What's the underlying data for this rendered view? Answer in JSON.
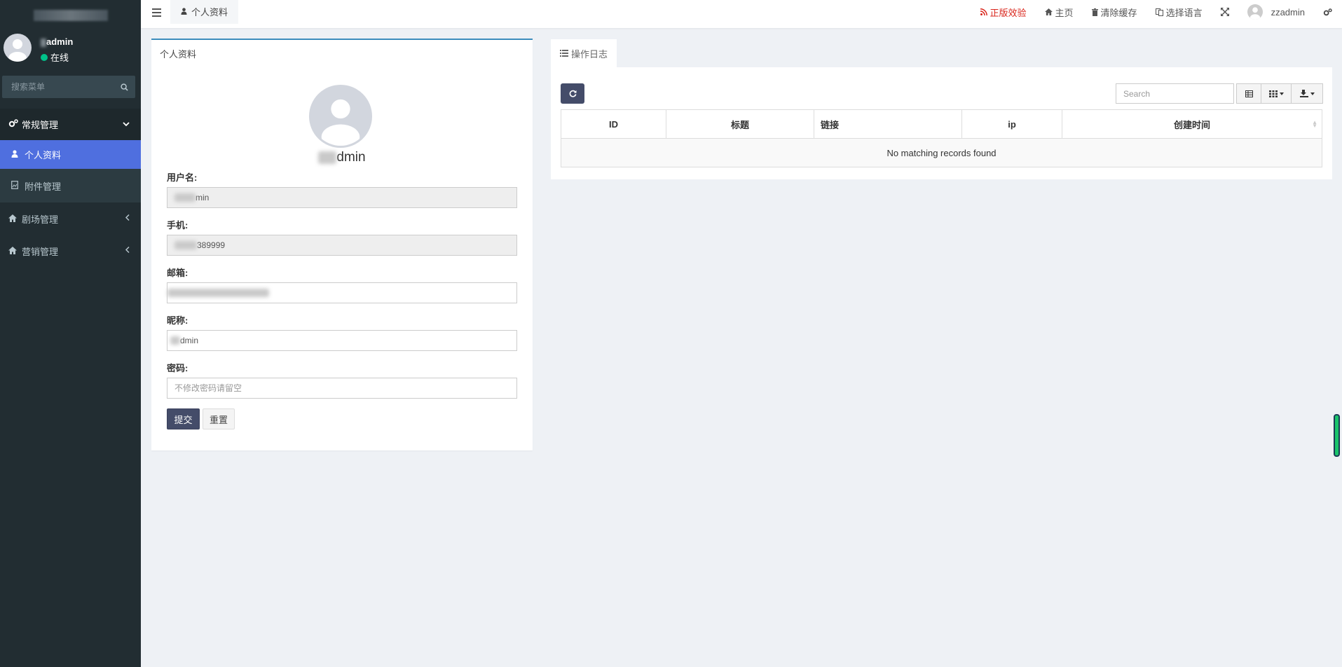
{
  "sidebar": {
    "user": {
      "name_suffix": "admin",
      "status": "在线"
    },
    "search": {
      "placeholder": "搜索菜单"
    },
    "menu": {
      "general": "常规管理",
      "profile": "个人资料",
      "attachments": "附件管理",
      "theater": "剧场管理",
      "marketing": "营销管理"
    }
  },
  "topbar": {
    "tab_label": "个人资料",
    "verify": "正版效验",
    "home": "主页",
    "clear_cache": "清除缓存",
    "language": "选择语言",
    "username": "zzadmin"
  },
  "profile": {
    "title": "个人资料",
    "display_name_suffix": "dmin",
    "fields": {
      "username_label": "用户名:",
      "username_value": "min",
      "phone_label": "手机:",
      "phone_value": "389999",
      "email_label": "邮箱:",
      "nickname_label": "昵称:",
      "nickname_value": "dmin",
      "password_label": "密码:",
      "password_placeholder": "不修改密码请留空"
    },
    "submit": "提交",
    "reset": "重置"
  },
  "log": {
    "tab": "操作日志",
    "search_placeholder": "Search",
    "columns": [
      "ID",
      "标题",
      "链接",
      "ip",
      "创建时间"
    ],
    "empty": "No matching records found"
  },
  "colors": {
    "sidebar_bg": "#222d32",
    "active_item": "#4f6fdf",
    "primary_button": "#444c69",
    "link_red": "#d9261c"
  }
}
